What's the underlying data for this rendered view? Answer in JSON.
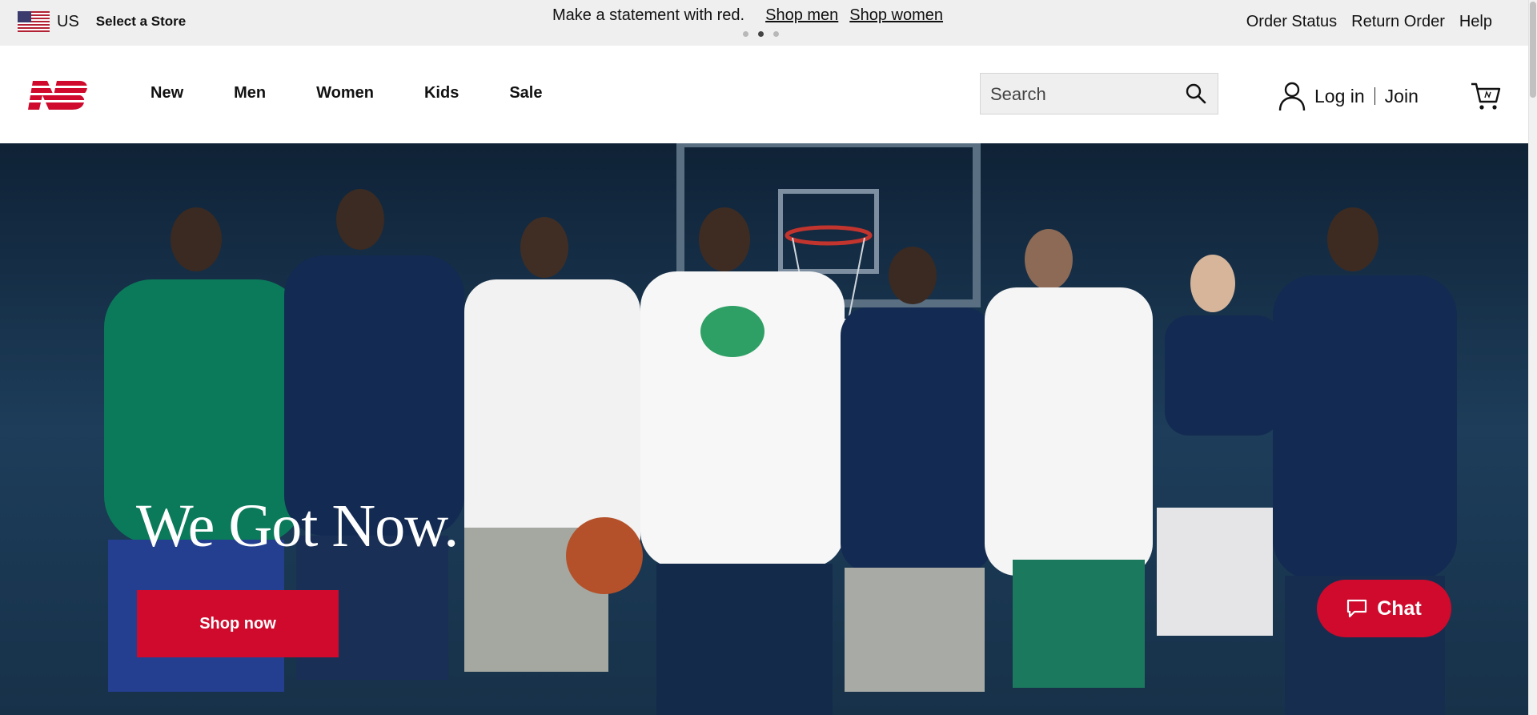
{
  "colors": {
    "accent": "#cf0a2c",
    "promo_bg": "#efefef",
    "hero_bg": "#1a3550"
  },
  "promo_bar": {
    "locale_code": "US",
    "select_store": "Select a Store",
    "message": "Make a statement with red.",
    "links": [
      "Shop men",
      "Shop women"
    ],
    "carousel": {
      "slide_count": 3,
      "active_index": 1
    },
    "utility_links": [
      "Order Status",
      "Return Order",
      "Help"
    ]
  },
  "header": {
    "logo_icon": "new-balance-logo",
    "nav": [
      "New",
      "Men",
      "Women",
      "Kids",
      "Sale"
    ],
    "search": {
      "placeholder": "Search",
      "icon": "search-icon"
    },
    "account": {
      "icon": "user-icon",
      "login": "Log in",
      "join": "Join"
    },
    "cart_icon": "cart-icon"
  },
  "hero": {
    "title": "We Got Now.",
    "cta": "Shop now"
  },
  "chat": {
    "label": "Chat",
    "icon": "chat-bubble-icon"
  }
}
